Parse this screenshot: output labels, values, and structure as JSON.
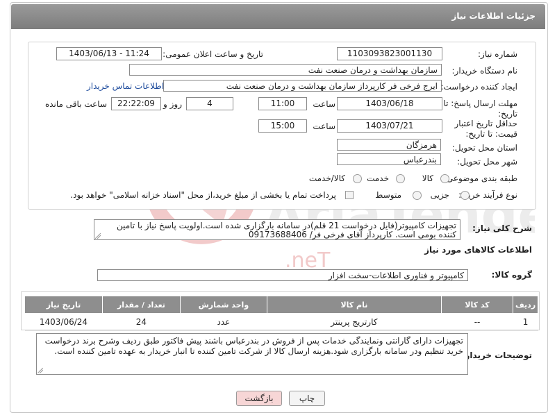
{
  "header": {
    "title": "جزئیات اطلاعات نیاز"
  },
  "fields": {
    "need_number_label": "شماره نیاز:",
    "need_number": "1103093823001130",
    "announce_label": "تاریخ و ساعت اعلان عمومی:",
    "announce_value": "1403/06/13 - 11:24",
    "buyer_org_label": "نام دستگاه خریدار:",
    "buyer_org": "سازمان بهداشت و درمان صنعت نفت",
    "requester_label": "ایجاد کننده درخواست:",
    "requester": "ایرج فرخی فر کارپرداز  سازمان بهداشت و درمان صنعت نفت",
    "contact_link": "اطلاعات تماس خریدار",
    "deadline_label": "مهلت ارسال پاسخ: تا تاریخ:",
    "deadline_date": "1403/06/18",
    "time_label": "ساعت",
    "deadline_time": "11:00",
    "days_value": "4",
    "days_label": "روز و",
    "remaining_time": "22:22:09",
    "remaining_label": "ساعت باقی مانده",
    "validity_label": "حداقل تاریخ اعتبار قیمت: تا تاریخ:",
    "validity_date": "1403/07/21",
    "validity_time_label": "ساعت",
    "validity_time": "15:00",
    "province_label": "استان محل تحویل:",
    "province": "هرمزگان",
    "city_label": "شهر محل تحویل:",
    "city": "بندرعباس",
    "category_label": "طبقه بندی موضوعی:",
    "category_options": [
      "کالا",
      "خدمت",
      "کالا/خدمت"
    ],
    "process_label": "نوع فرآیند خرید :",
    "process_options": [
      "جزیی",
      "متوسط"
    ],
    "payment_text": "پرداخت تمام یا بخشی از مبلغ خرید،از محل \"اسناد خزانه اسلامی\" خواهد بود."
  },
  "description": {
    "label": "شرح کلی نیاز:",
    "text": "تجهیزات کامپیوتر(فایل درخواست 21 قلم)در سامانه بارگزاری شده است.اولویت پاسخ نیاز با تامین کننده بومی است. کارپرداز آقای فرخی فر/ 09173688406"
  },
  "goods": {
    "section_title": "اطلاعات کالاهای مورد نیاز",
    "group_label": "گروه کالا:",
    "group_value": "کامپیوتر و فناوری اطلاعات-سخت افزار",
    "columns": [
      "ردیف",
      "کد کالا",
      "نام کالا",
      "واحد شمارش",
      "تعداد / مقدار",
      "تاریخ نیاز"
    ],
    "rows": [
      {
        "row": "1",
        "code": "--",
        "name": "کارتریج پرینتر",
        "unit": "عدد",
        "qty": "24",
        "date": "1403/06/24"
      }
    ]
  },
  "buyer_notes": {
    "label": "توضیحات خریدار:",
    "text": "تجهیزات دارای گارانتی ونمایندگی خدمات پس از فروش در بندرعباس باشند پیش فاکتور طبق ردیف وشرح برند درخواست خرید تنظیم ودر سامانه بارگزاری شود.هزینه ارسال کالا از شرکت تامین کننده تا انبار خریدار به عهده تامین کننده است."
  },
  "buttons": {
    "print": "چاپ",
    "back": "بازگشت"
  },
  "colors": {
    "header": "#8a8a8a",
    "link": "#1c4a9c",
    "back_button": "#f7d6d6"
  }
}
